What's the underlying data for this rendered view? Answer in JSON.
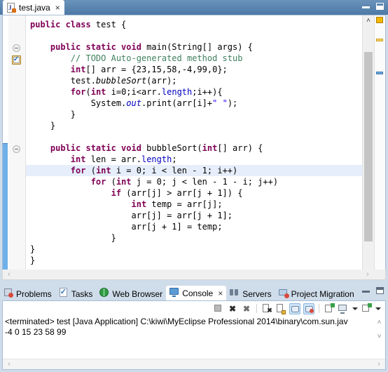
{
  "editor": {
    "tab": {
      "label": "test.java",
      "close": "×",
      "icon": "java-file-icon"
    },
    "window_controls": {
      "minimize": "minimize-icon",
      "maximize": "maximize-icon"
    },
    "gutter": {
      "todo_marker": "task-todo-marker",
      "fold_icons": [
        "collapse-fold-icon",
        "collapse-fold-icon"
      ]
    },
    "code_lines": [
      {
        "indent": 0,
        "tokens": [
          {
            "t": "kw",
            "v": "public class"
          },
          {
            "t": "pl",
            "v": " test {"
          }
        ]
      },
      {
        "indent": 0,
        "tokens": [
          {
            "t": "pl",
            "v": ""
          }
        ]
      },
      {
        "indent": 1,
        "tokens": [
          {
            "t": "kw",
            "v": "public static void"
          },
          {
            "t": "pl",
            "v": " main(String[] args) {"
          }
        ]
      },
      {
        "indent": 2,
        "tokens": [
          {
            "t": "cmt",
            "v": "// TODO Auto-generated method stub"
          }
        ]
      },
      {
        "indent": 2,
        "tokens": [
          {
            "t": "kw",
            "v": "int"
          },
          {
            "t": "pl",
            "v": "[] arr = {23,15,58,-4,99,0};"
          }
        ]
      },
      {
        "indent": 2,
        "tokens": [
          {
            "t": "pl",
            "v": "test."
          },
          {
            "t": "mth",
            "v": "bubbleSort"
          },
          {
            "t": "pl",
            "v": "(arr);"
          }
        ]
      },
      {
        "indent": 2,
        "tokens": [
          {
            "t": "kw",
            "v": "for"
          },
          {
            "t": "pl",
            "v": "("
          },
          {
            "t": "kw",
            "v": "int"
          },
          {
            "t": "pl",
            "v": " i=0;i<arr."
          },
          {
            "t": "fld",
            "v": "length"
          },
          {
            "t": "pl",
            "v": ";i++){"
          }
        ]
      },
      {
        "indent": 3,
        "tokens": [
          {
            "t": "pl",
            "v": "System."
          },
          {
            "t": "stat",
            "v": "out"
          },
          {
            "t": "pl",
            "v": ".print(arr[i]+"
          },
          {
            "t": "str",
            "v": "\" \""
          },
          {
            "t": "pl",
            "v": ");"
          }
        ]
      },
      {
        "indent": 2,
        "tokens": [
          {
            "t": "pl",
            "v": "}"
          }
        ]
      },
      {
        "indent": 1,
        "tokens": [
          {
            "t": "pl",
            "v": "}"
          }
        ]
      },
      {
        "indent": 0,
        "tokens": [
          {
            "t": "pl",
            "v": ""
          }
        ]
      },
      {
        "indent": 1,
        "tokens": [
          {
            "t": "kw",
            "v": "public static void"
          },
          {
            "t": "pl",
            "v": " bubbleSort("
          },
          {
            "t": "kw",
            "v": "int"
          },
          {
            "t": "pl",
            "v": "[] arr) {"
          }
        ]
      },
      {
        "indent": 2,
        "tokens": [
          {
            "t": "kw",
            "v": "int"
          },
          {
            "t": "pl",
            "v": " len = arr."
          },
          {
            "t": "fld",
            "v": "length"
          },
          {
            "t": "pl",
            "v": ";"
          }
        ]
      },
      {
        "indent": 2,
        "highlight": true,
        "tokens": [
          {
            "t": "kw",
            "v": "for"
          },
          {
            "t": "pl",
            "v": " ("
          },
          {
            "t": "kw",
            "v": "int"
          },
          {
            "t": "pl",
            "v": " i = 0; i < len - 1; i++)"
          }
        ]
      },
      {
        "indent": 3,
        "tokens": [
          {
            "t": "kw",
            "v": "for"
          },
          {
            "t": "pl",
            "v": " ("
          },
          {
            "t": "kw",
            "v": "int"
          },
          {
            "t": "pl",
            "v": " j = 0; j < len - 1 - i; j++)"
          }
        ]
      },
      {
        "indent": 4,
        "tokens": [
          {
            "t": "kw",
            "v": "if"
          },
          {
            "t": "pl",
            "v": " (arr[j] > arr[j + 1]) {"
          }
        ]
      },
      {
        "indent": 5,
        "tokens": [
          {
            "t": "kw",
            "v": "int"
          },
          {
            "t": "pl",
            "v": " temp = arr[j];"
          }
        ]
      },
      {
        "indent": 5,
        "tokens": [
          {
            "t": "pl",
            "v": "arr[j] = arr[j + 1];"
          }
        ]
      },
      {
        "indent": 5,
        "tokens": [
          {
            "t": "pl",
            "v": "arr[j + 1] = temp;"
          }
        ]
      },
      {
        "indent": 4,
        "tokens": [
          {
            "t": "pl",
            "v": "}"
          }
        ]
      },
      {
        "indent": 0,
        "tokens": [
          {
            "t": "pl",
            "v": "}"
          }
        ]
      },
      {
        "indent": 0,
        "tokens": [
          {
            "t": "pl",
            "v": "}"
          }
        ]
      }
    ],
    "vscroll": {
      "up_arrow": "˄",
      "down_arrow": "˅"
    },
    "hscroll": {
      "left_arrow": "‹",
      "right_arrow": "›"
    },
    "overview_ruler_markers": [
      "marker-orange",
      "marker-warning",
      "marker-info"
    ]
  },
  "console_panel": {
    "tabs": [
      {
        "label": "Problems",
        "icon": "problems-icon",
        "selected": false
      },
      {
        "label": "Tasks",
        "icon": "tasks-icon",
        "selected": false
      },
      {
        "label": "Web Browser",
        "icon": "web-browser-icon",
        "selected": false
      },
      {
        "label": "Console",
        "icon": "console-icon",
        "selected": true,
        "close": "×"
      },
      {
        "label": "Servers",
        "icon": "servers-icon",
        "selected": false
      },
      {
        "label": "Project Migration",
        "icon": "project-migration-icon",
        "selected": false
      }
    ],
    "window_controls": {
      "minimize": "minimize-icon",
      "maximize": "maximize-icon"
    },
    "toolbar_buttons": [
      "terminate-icon",
      "remove-launch-icon",
      "remove-all-terminated-icon",
      "clear-console-icon",
      "scroll-lock-icon",
      "show-console-on-output-icon",
      "show-console-on-error-icon",
      "pin-console-icon",
      "display-selected-console-icon",
      "display-selected-console-dropdown-icon",
      "open-console-icon",
      "open-console-dropdown-icon"
    ],
    "output_lines": [
      "<terminated> test [Java Application] C:\\kiwi\\MyEclipse Professional 2014\\binary\\com.sun.jav",
      "-4 0 15 23 58 99"
    ],
    "vscroll": {
      "up_arrow": "˄",
      "down_arrow": "˅"
    },
    "hscroll": {
      "left_arrow": "‹",
      "right_arrow": "›"
    }
  },
  "colors": {
    "titlebar": "#5b85b0",
    "keyword": "#7f0055",
    "comment": "#3f7f5f",
    "field": "#0000c0",
    "string": "#2a00ff",
    "current_line": "#e6eefb",
    "change_bar": "#6fb0e8"
  }
}
